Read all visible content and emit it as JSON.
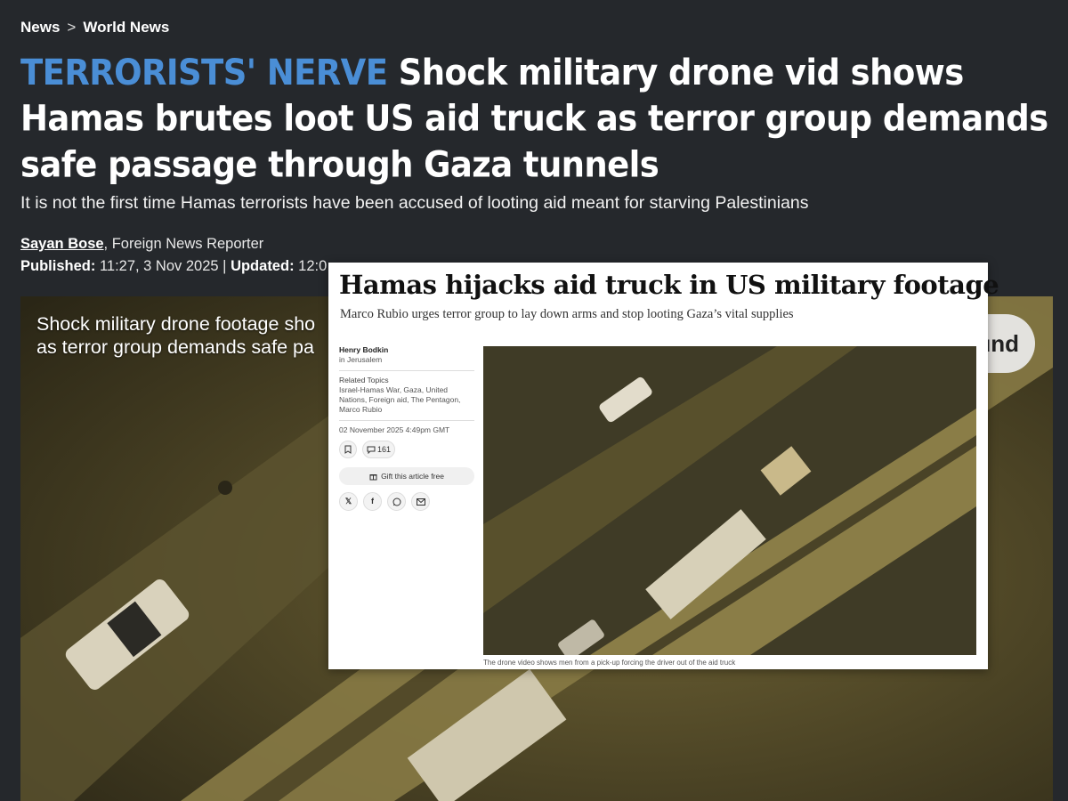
{
  "breadcrumb": {
    "items": [
      "News",
      "World News"
    ],
    "separator": ">"
  },
  "headline": {
    "kicker": "TERRORISTS' NERVE",
    "text": "Shock military drone vid shows Hamas brutes loot US aid truck as terror group demands safe passage through Gaza tunnels"
  },
  "standfirst": "It is not the first time Hamas terrorists have been accused of looting aid meant for starving Palestinians",
  "byline": {
    "author": "Sayan Bose",
    "role": ", Foreign News Reporter"
  },
  "dates": {
    "published_label": "Published:",
    "published": "11:27, 3 Nov 2025",
    "separator": "|",
    "updated_label": "Updated:",
    "updated": "12:0"
  },
  "video": {
    "caption_line1": "Shock military drone footage sho",
    "caption_line2": "as terror group demands safe pa",
    "sound_button": "und"
  },
  "inset": {
    "title": "Hamas hijacks aid truck in US military footage",
    "subtitle": "Marco Rubio urges terror group to lay down arms and stop looting Gaza’s vital supplies",
    "author": "Henry Bodkin",
    "location": "in Jerusalem",
    "related_label": "Related Topics",
    "related_topics": "Israel-Hamas War, Gaza, United Nations, Foreign aid, The Pentagon, Marco Rubio",
    "date": "02 November 2025 4:49pm GMT",
    "comments": "161",
    "gift": "Gift this article free",
    "share_icons": [
      "x-icon",
      "facebook-icon",
      "whatsapp-icon",
      "email-icon"
    ],
    "photo_caption": "The drone video shows men from a pick-up forcing the driver out of the aid truck"
  },
  "colors": {
    "background": "#25282c",
    "kicker": "#4a8ed6",
    "inset_bg": "#ffffff"
  }
}
